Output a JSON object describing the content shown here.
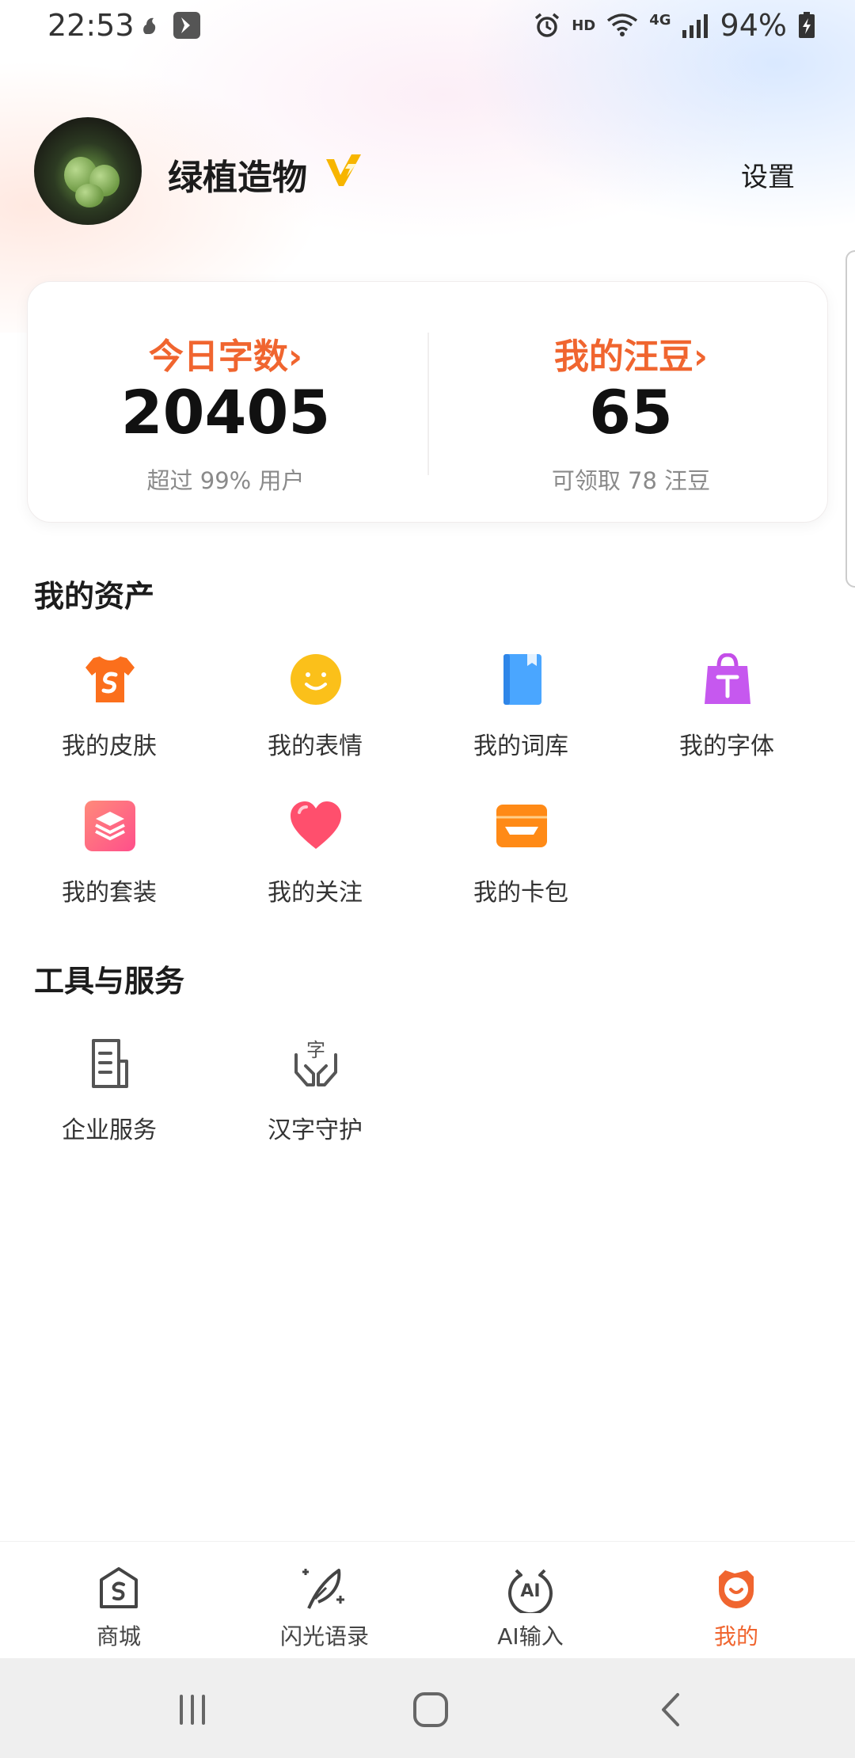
{
  "status_bar": {
    "time": "22:53",
    "network": "4G",
    "hd": "HD",
    "battery": "94%"
  },
  "profile": {
    "username": "绿植造物",
    "settings_label": "设置"
  },
  "stats": {
    "words_today": {
      "title": "今日字数",
      "arrow": "›",
      "value": "20405",
      "sub": "超过 99% 用户"
    },
    "beans": {
      "title": "我的汪豆",
      "arrow": "›",
      "value": "65",
      "sub": "可领取 78 汪豆"
    }
  },
  "assets": {
    "title": "我的资产",
    "items": [
      {
        "label": "我的皮肤",
        "icon": "shirt-icon"
      },
      {
        "label": "我的表情",
        "icon": "emoji-icon"
      },
      {
        "label": "我的词库",
        "icon": "book-icon"
      },
      {
        "label": "我的字体",
        "icon": "font-bag-icon"
      },
      {
        "label": "我的套装",
        "icon": "layers-icon"
      },
      {
        "label": "我的关注",
        "icon": "heart-icon"
      },
      {
        "label": "我的卡包",
        "icon": "wallet-icon"
      }
    ]
  },
  "tools": {
    "title": "工具与服务",
    "items": [
      {
        "label": "企业服务",
        "icon": "document-icon"
      },
      {
        "label": "汉字守护",
        "icon": "hands-character-icon"
      }
    ]
  },
  "bottom_nav": {
    "items": [
      {
        "label": "商城",
        "icon": "shop-icon"
      },
      {
        "label": "闪光语录",
        "icon": "quill-icon"
      },
      {
        "label": "AI输入",
        "icon": "ai-icon"
      },
      {
        "label": "我的",
        "icon": "me-icon",
        "active": true
      }
    ]
  },
  "colors": {
    "accent": "#f0652f",
    "text": "#1c1c1c",
    "muted": "#8a8a8a"
  }
}
